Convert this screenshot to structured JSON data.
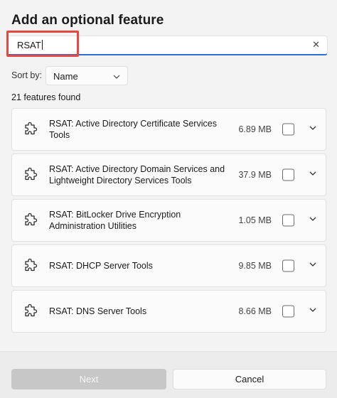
{
  "dialog": {
    "title": "Add an optional feature"
  },
  "search": {
    "value": "RSAT",
    "clear_icon": "close-icon"
  },
  "sort": {
    "label": "Sort by:",
    "selected": "Name"
  },
  "results": {
    "count_text": "21 features found"
  },
  "features": [
    {
      "name": "RSAT: Active Directory Certificate Services Tools",
      "size": "6.89 MB",
      "checked": false
    },
    {
      "name": "RSAT: Active Directory Domain Services and Lightweight Directory Services Tools",
      "size": "37.9 MB",
      "checked": false
    },
    {
      "name": "RSAT: BitLocker Drive Encryption Administration Utilities",
      "size": "1.05 MB",
      "checked": false
    },
    {
      "name": "RSAT: DHCP Server Tools",
      "size": "9.85 MB",
      "checked": false
    },
    {
      "name": "RSAT: DNS Server Tools",
      "size": "8.66 MB",
      "checked": false
    }
  ],
  "footer": {
    "next_label": "Next",
    "cancel_label": "Cancel"
  },
  "colors": {
    "accent": "#2f6fcf",
    "highlight": "#e8473d",
    "disabled_button": "#c7c7c7"
  }
}
